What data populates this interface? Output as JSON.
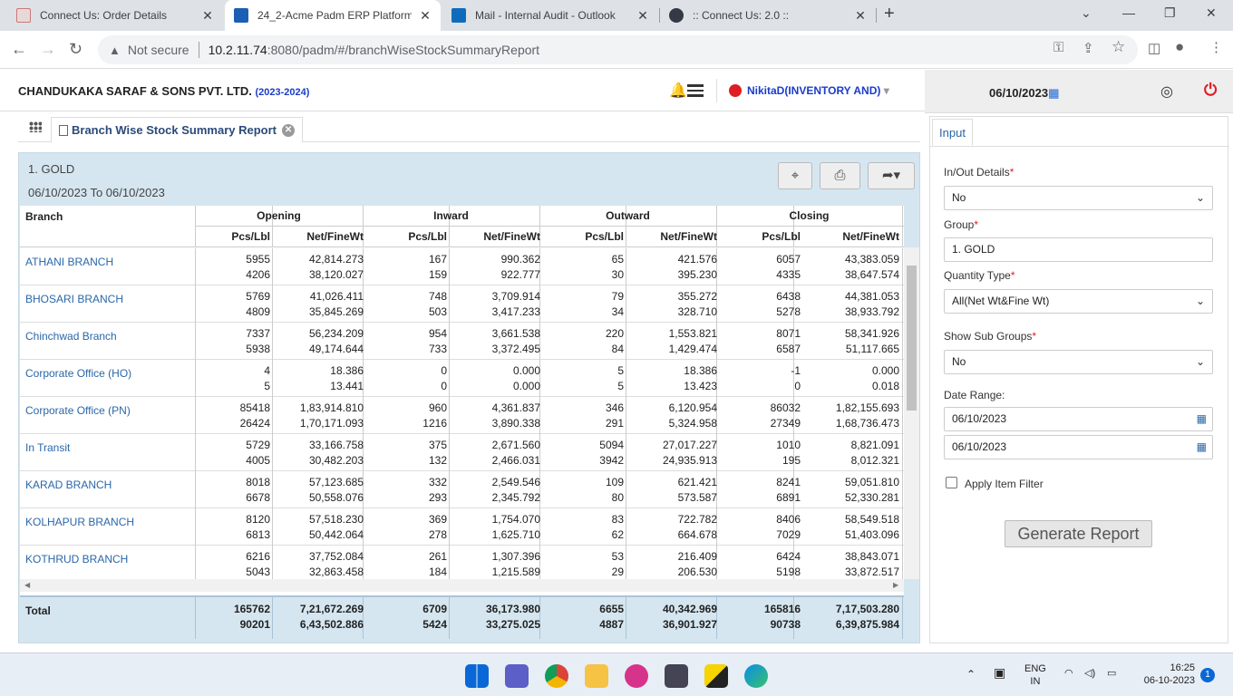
{
  "browser": {
    "tabs": [
      {
        "title": "Connect Us: Order Details",
        "color": "#e0e0e0"
      },
      {
        "title": "24_2-Acme Padm ERP Platform",
        "color": "#1a5fb4"
      },
      {
        "title": "Mail - Internal Audit - Outlook",
        "color": "#0f6cbd"
      },
      {
        "title": ":: Connect Us: 2.0 ::",
        "color": "#333a45"
      }
    ],
    "security": "Not secure",
    "url_host": "10.2.11.74",
    "url_path": ":8080/padm/#/branchWiseStockSummaryReport"
  },
  "header": {
    "company": "CHANDUKAKA SARAF & SONS PVT. LTD.",
    "year": "(2023-2024)",
    "user": "NikitaD",
    "role": "(INVENTORY AND)",
    "date": "06/10/2023"
  },
  "report": {
    "tab_label": "Branch Wise Stock Summary Report",
    "group_title": "1. GOLD",
    "date_range": "06/10/2023 To 06/10/2023",
    "col_branch": "Branch",
    "groups": [
      "Opening",
      "Inward",
      "Outward",
      "Closing"
    ],
    "sub_pcs": "Pcs/Lbl",
    "sub_net": "Net/FineWt",
    "rows": [
      {
        "branch": "ATHANI BRANCH",
        "v": [
          [
            "5955",
            "4206"
          ],
          [
            "42,814.273",
            "38,120.027"
          ],
          [
            "167",
            "159"
          ],
          [
            "990.362",
            "922.777"
          ],
          [
            "65",
            "30"
          ],
          [
            "421.576",
            "395.230"
          ],
          [
            "6057",
            "4335"
          ],
          [
            "43,383.059",
            "38,647.574"
          ]
        ]
      },
      {
        "branch": "BHOSARI BRANCH",
        "v": [
          [
            "5769",
            "4809"
          ],
          [
            "41,026.411",
            "35,845.269"
          ],
          [
            "748",
            "503"
          ],
          [
            "3,709.914",
            "3,417.233"
          ],
          [
            "79",
            "34"
          ],
          [
            "355.272",
            "328.710"
          ],
          [
            "6438",
            "5278"
          ],
          [
            "44,381.053",
            "38,933.792"
          ]
        ]
      },
      {
        "branch": "Chinchwad Branch",
        "v": [
          [
            "7337",
            "5938"
          ],
          [
            "56,234.209",
            "49,174.644"
          ],
          [
            "954",
            "733"
          ],
          [
            "3,661.538",
            "3,372.495"
          ],
          [
            "220",
            "84"
          ],
          [
            "1,553.821",
            "1,429.474"
          ],
          [
            "8071",
            "6587"
          ],
          [
            "58,341.926",
            "51,117.665"
          ]
        ]
      },
      {
        "branch": "Corporate Office (HO)",
        "v": [
          [
            "4",
            "5"
          ],
          [
            "18.386",
            "13.441"
          ],
          [
            "0",
            "0"
          ],
          [
            "0.000",
            "0.000"
          ],
          [
            "5",
            "5"
          ],
          [
            "18.386",
            "13.423"
          ],
          [
            "-1",
            "0"
          ],
          [
            "0.000",
            "0.018"
          ]
        ]
      },
      {
        "branch": "Corporate Office (PN)",
        "v": [
          [
            "85418",
            "26424"
          ],
          [
            "1,83,914.810",
            "1,70,171.093"
          ],
          [
            "960",
            "1216"
          ],
          [
            "4,361.837",
            "3,890.338"
          ],
          [
            "346",
            "291"
          ],
          [
            "6,120.954",
            "5,324.958"
          ],
          [
            "86032",
            "27349"
          ],
          [
            "1,82,155.693",
            "1,68,736.473"
          ]
        ]
      },
      {
        "branch": "In Transit",
        "v": [
          [
            "5729",
            "4005"
          ],
          [
            "33,166.758",
            "30,482.203"
          ],
          [
            "375",
            "132"
          ],
          [
            "2,671.560",
            "2,466.031"
          ],
          [
            "5094",
            "3942"
          ],
          [
            "27,017.227",
            "24,935.913"
          ],
          [
            "1010",
            "195"
          ],
          [
            "8,821.091",
            "8,012.321"
          ]
        ]
      },
      {
        "branch": "KARAD BRANCH",
        "v": [
          [
            "8018",
            "6678"
          ],
          [
            "57,123.685",
            "50,558.076"
          ],
          [
            "332",
            "293"
          ],
          [
            "2,549.546",
            "2,345.792"
          ],
          [
            "109",
            "80"
          ],
          [
            "621.421",
            "573.587"
          ],
          [
            "8241",
            "6891"
          ],
          [
            "59,051.810",
            "52,330.281"
          ]
        ]
      },
      {
        "branch": "KOLHAPUR BRANCH",
        "v": [
          [
            "8120",
            "6813"
          ],
          [
            "57,518.230",
            "50,442.064"
          ],
          [
            "369",
            "278"
          ],
          [
            "1,754.070",
            "1,625.710"
          ],
          [
            "83",
            "62"
          ],
          [
            "722.782",
            "664.678"
          ],
          [
            "8406",
            "7029"
          ],
          [
            "58,549.518",
            "51,403.096"
          ]
        ]
      },
      {
        "branch": "KOTHRUD BRANCH",
        "v": [
          [
            "6216",
            "5043"
          ],
          [
            "37,752.084",
            "32,863.458"
          ],
          [
            "261",
            "184"
          ],
          [
            "1,307.396",
            "1,215.589"
          ],
          [
            "53",
            "29"
          ],
          [
            "216.409",
            "206.530"
          ],
          [
            "6424",
            "5198"
          ],
          [
            "38,843.071",
            "33,872.517"
          ]
        ]
      }
    ],
    "total_label": "Total",
    "total": [
      [
        "165762",
        "90201"
      ],
      [
        "7,21,672.269",
        "6,43,502.886"
      ],
      [
        "6709",
        "5424"
      ],
      [
        "36,173.980",
        "33,275.025"
      ],
      [
        "6655",
        "4887"
      ],
      [
        "40,342.969",
        "36,901.927"
      ],
      [
        "165816",
        "90738"
      ],
      [
        "7,17,503.280",
        "6,39,875.984"
      ]
    ]
  },
  "input_panel": {
    "tab": "Input",
    "inout_label": "In/Out Details",
    "inout_value": "No",
    "group_label": "Group",
    "group_value": "1. GOLD",
    "qty_label": "Quantity Type",
    "qty_value": "All(Net Wt&Fine Wt)",
    "subgroups_label": "Show Sub Groups",
    "subgroups_value": "No",
    "daterange_label": "Date Range:",
    "date_from": "06/10/2023",
    "date_to": "06/10/2023",
    "apply_filter": "Apply Item Filter",
    "generate": "Generate Report"
  },
  "taskbar": {
    "lang1": "ENG",
    "lang2": "IN",
    "time": "16:25",
    "date": "06-10-2023",
    "notif": "1"
  }
}
